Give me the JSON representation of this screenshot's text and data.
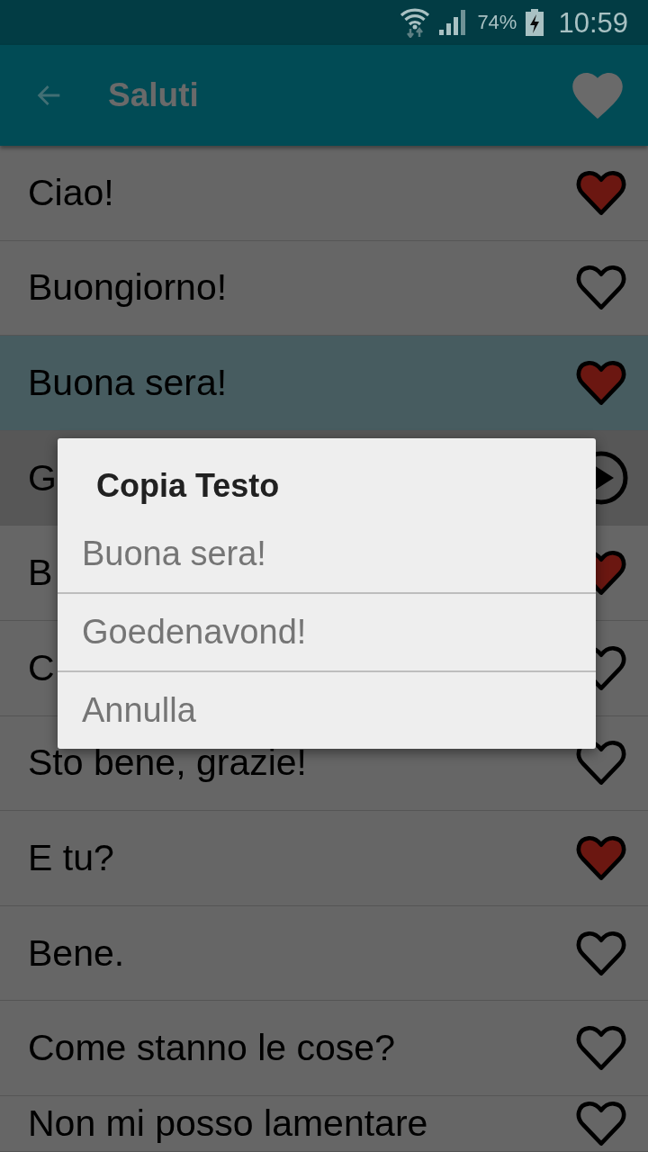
{
  "status_bar": {
    "battery_percent": "74%",
    "time": "10:59"
  },
  "app_bar": {
    "title": "Saluti"
  },
  "rows": [
    {
      "kind": "phrase",
      "text": "Ciao!",
      "favorite": true,
      "selected": false
    },
    {
      "kind": "phrase",
      "text": "Buongiorno!",
      "favorite": false,
      "selected": false
    },
    {
      "kind": "phrase",
      "text": "Buona sera!",
      "favorite": true,
      "selected": true
    },
    {
      "kind": "translation",
      "text": "G",
      "selected": false
    },
    {
      "kind": "phrase",
      "text": "B",
      "favorite": true,
      "selected": false
    },
    {
      "kind": "phrase",
      "text": "C",
      "favorite": false,
      "selected": false
    },
    {
      "kind": "phrase",
      "text": "Sto bene, grazie!",
      "favorite": false,
      "selected": false
    },
    {
      "kind": "phrase",
      "text": "E tu?",
      "favorite": true,
      "selected": false
    },
    {
      "kind": "phrase",
      "text": "Bene.",
      "favorite": false,
      "selected": false
    },
    {
      "kind": "phrase",
      "text": "Come stanno le cose?",
      "favorite": false,
      "selected": false
    },
    {
      "kind": "phrase",
      "text": "Non mi posso lamentare",
      "favorite": false,
      "selected": false
    }
  ],
  "dialog": {
    "title": "Copia Testo",
    "options": [
      "Buona sera!",
      "Goedenavond!",
      "Annulla"
    ]
  }
}
